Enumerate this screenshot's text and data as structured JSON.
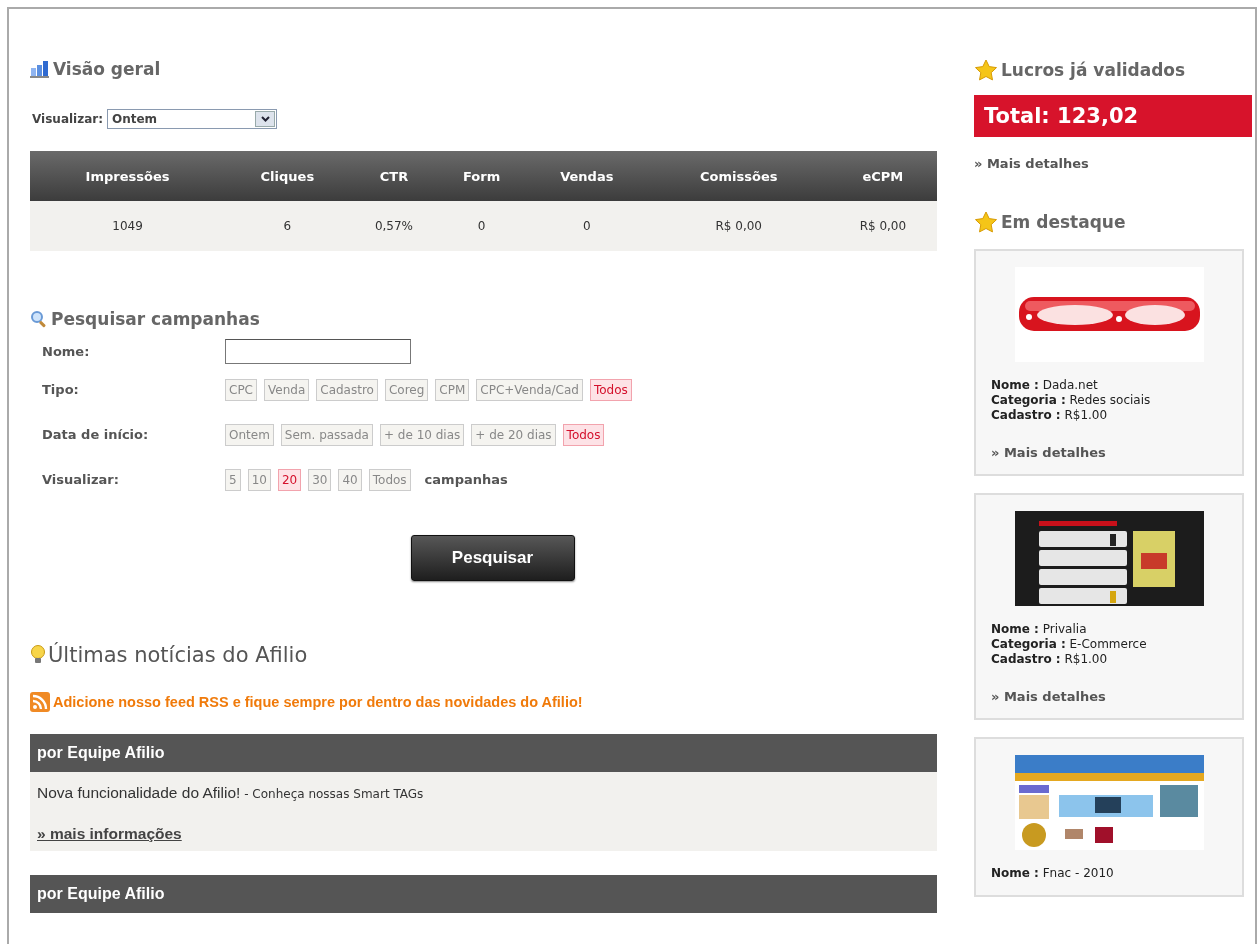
{
  "overview": {
    "title": "Visão geral",
    "view_label": "Visualizar:",
    "view_value": "Ontem",
    "table": {
      "columns": [
        "Impressões",
        "Cliques",
        "CTR",
        "Form",
        "Vendas",
        "Comissões",
        "eCPM"
      ],
      "rows": [
        [
          "1049",
          "6",
          "0,57%",
          "0",
          "0",
          "R$ 0,00",
          "R$ 0,00"
        ]
      ]
    }
  },
  "search": {
    "title": "Pesquisar campanhas",
    "fields": [
      {
        "kind": "text",
        "label": "Nome:"
      },
      {
        "kind": "chips",
        "label": "Tipo:",
        "options": [
          {
            "label": "CPC",
            "selected": false
          },
          {
            "label": "Venda",
            "selected": false
          },
          {
            "label": "Cadastro",
            "selected": false
          },
          {
            "label": "Coreg",
            "selected": false
          },
          {
            "label": "CPM",
            "selected": false
          },
          {
            "label": "CPC+Venda/Cad",
            "selected": false
          },
          {
            "label": "Todos",
            "selected": true
          }
        ]
      },
      {
        "kind": "chips",
        "label": "Data de início:",
        "options": [
          {
            "label": "Ontem",
            "selected": false
          },
          {
            "label": "Sem. passada",
            "selected": false
          },
          {
            "label": "+ de 10 dias",
            "selected": false
          },
          {
            "label": "+ de 20 dias",
            "selected": false
          },
          {
            "label": "Todos",
            "selected": true
          }
        ]
      },
      {
        "kind": "chips",
        "label": "Visualizar:",
        "suffix": "campanhas",
        "options": [
          {
            "label": "5",
            "selected": false
          },
          {
            "label": "10",
            "selected": false
          },
          {
            "label": "20",
            "selected": true
          },
          {
            "label": "30",
            "selected": false
          },
          {
            "label": "40",
            "selected": false
          },
          {
            "label": "Todos",
            "selected": false
          }
        ]
      }
    ],
    "button": "Pesquisar"
  },
  "news": {
    "title": "Últimas notícias do Afilio",
    "rss_text": "Adicione nosso feed RSS e fique sempre por dentro das novidades do Afilio!",
    "posts": [
      {
        "author": "por Equipe Afilio",
        "headline": "Nova funcionalidade do Afilio!",
        "summary": "- Conheça nossas Smart TAGs",
        "link": "» mais informações"
      },
      {
        "author": "por Equipe Afilio"
      }
    ]
  },
  "profits": {
    "title": "Lucros já validados",
    "total": "Total: 123,02",
    "link": "» Mais detalhes"
  },
  "featured": {
    "title": "Em destaque",
    "items": [
      {
        "kind": "picture",
        "lines": [
          "**Nome :** Dada.net",
          "**Categoria :** Redes sociais",
          "**Cadastro :** R$1.00"
        ],
        "link": "» Mais detalhes"
      },
      {
        "kind": "picture",
        "lines": [
          "**Nome :** Privalia",
          "**Categoria :** E-Commerce",
          "**Cadastro :** R$1.00"
        ],
        "link": "» Mais detalhes"
      },
      {
        "kind": "picture",
        "lines": [
          "**Nome :** Fnac - 2010"
        ]
      }
    ]
  }
}
